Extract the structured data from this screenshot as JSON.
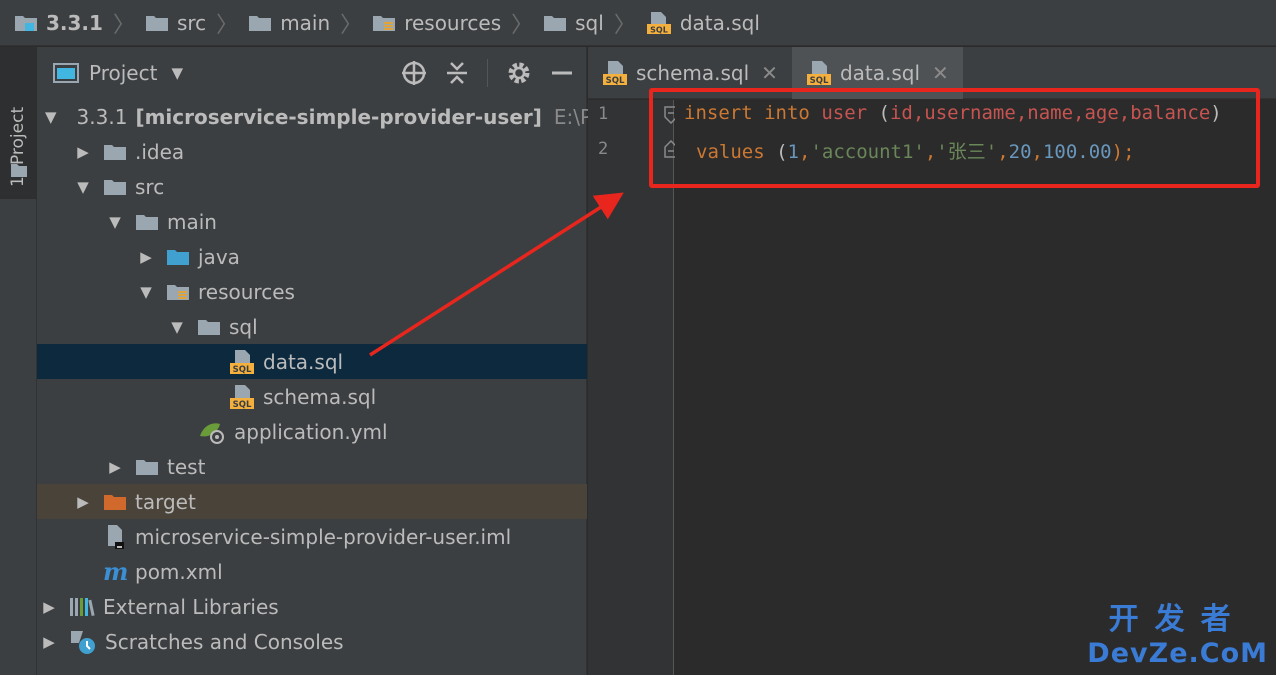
{
  "breadcrumb": [
    "3.3.1",
    "src",
    "main",
    "resources",
    "sql",
    "data.sql"
  ],
  "side_stripe": {
    "label": "1: Project"
  },
  "project_panel": {
    "title": "Project",
    "tree": [
      {
        "label": "3.3.1",
        "module": "[microservice-simple-provider-user]",
        "path": "E:\\P"
      },
      {
        "label": ".idea"
      },
      {
        "label": "src"
      },
      {
        "label": "main"
      },
      {
        "label": "java"
      },
      {
        "label": "resources"
      },
      {
        "label": "sql"
      },
      {
        "label": "data.sql"
      },
      {
        "label": "schema.sql"
      },
      {
        "label": "application.yml"
      },
      {
        "label": "test"
      },
      {
        "label": "target"
      },
      {
        "label": "microservice-simple-provider-user.iml"
      },
      {
        "label": "pom.xml"
      },
      {
        "label": "External Libraries"
      },
      {
        "label": "Scratches and Consoles"
      }
    ]
  },
  "editor": {
    "tabs": [
      {
        "label": "schema.sql",
        "active": false
      },
      {
        "label": "data.sql",
        "active": true
      }
    ],
    "line_numbers": [
      "1",
      "2"
    ],
    "line1": {
      "kw1": "insert",
      "kw2": "into",
      "table": "user",
      "open": "(",
      "cols": "id,username,name,age,balance",
      "close": ")"
    },
    "line2": {
      "kw": "values",
      "open": "(",
      "n1": "1",
      "c1": ",",
      "s1": "'account1'",
      "c2": ",",
      "s2": "'张三'",
      "c3": ",",
      "n2": "20",
      "c4": ",",
      "n3": "100.00",
      "close": ");"
    }
  },
  "watermark": {
    "cn": "开发者",
    "en": "DevZe.CoM"
  },
  "colors": {
    "annotation": "#e8261d",
    "selection": "#0d293e",
    "excluded": "#4a4339"
  }
}
